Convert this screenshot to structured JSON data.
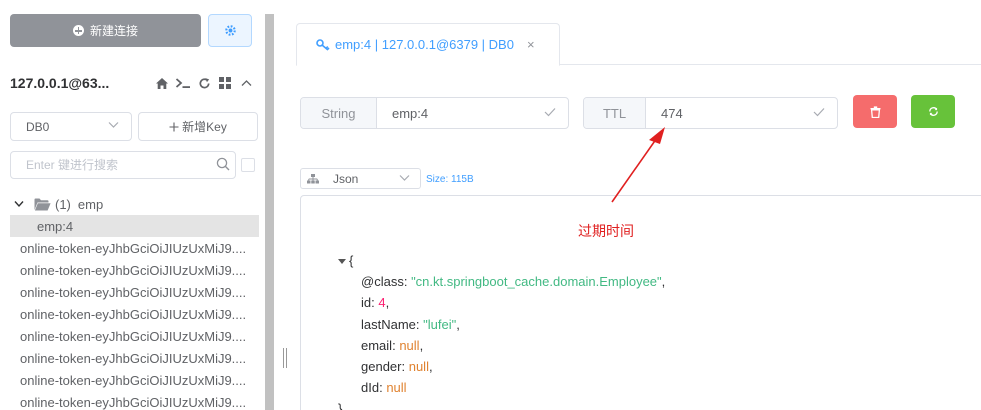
{
  "sidebar": {
    "new_connection_label": "新建连接",
    "connection_name": "127.0.0.1@63...",
    "db_select_value": "DB0",
    "new_key_label": "新增Key",
    "search_placeholder": "Enter 键进行搜索",
    "folder": {
      "count": "(1)",
      "name": "emp"
    },
    "selected_key": "emp:4",
    "keys": [
      "online-token-eyJhbGciOiJIUzUxMiJ9....",
      "online-token-eyJhbGciOiJIUzUxMiJ9....",
      "online-token-eyJhbGciOiJIUzUxMiJ9....",
      "online-token-eyJhbGciOiJIUzUxMiJ9....",
      "online-token-eyJhbGciOiJIUzUxMiJ9....",
      "online-token-eyJhbGciOiJIUzUxMiJ9....",
      "online-token-eyJhbGciOiJIUzUxMiJ9....",
      "online-token-eyJhbGciOiJIUzUxMiJ9...."
    ]
  },
  "tab": {
    "label": "emp:4 | 127.0.0.1@6379 | DB0",
    "close": "×"
  },
  "key_info": {
    "type_label": "String",
    "key_name": "emp:4",
    "ttl_label": "TTL",
    "ttl_value": "474"
  },
  "viewer": {
    "format": "Json",
    "size": "Size: 115B",
    "annotation": "过期时间",
    "json": {
      "open_brace": "{",
      "close_brace": "}",
      "fields": [
        {
          "key": "@class",
          "value": "\"cn.kt.springboot_cache.domain.Employee\"",
          "kind": "str"
        },
        {
          "key": "id",
          "value": "4",
          "kind": "num"
        },
        {
          "key": "lastName",
          "value": "\"lufei\"",
          "kind": "str"
        },
        {
          "key": "email",
          "value": "null",
          "kind": "nul"
        },
        {
          "key": "gender",
          "value": "null",
          "kind": "nul"
        },
        {
          "key": "dId",
          "value": "null",
          "kind": "nul"
        }
      ]
    }
  },
  "colors": {
    "primary": "#409eff",
    "danger": "#f56c6c",
    "success": "#67c23a",
    "annotation": "#e02020"
  }
}
